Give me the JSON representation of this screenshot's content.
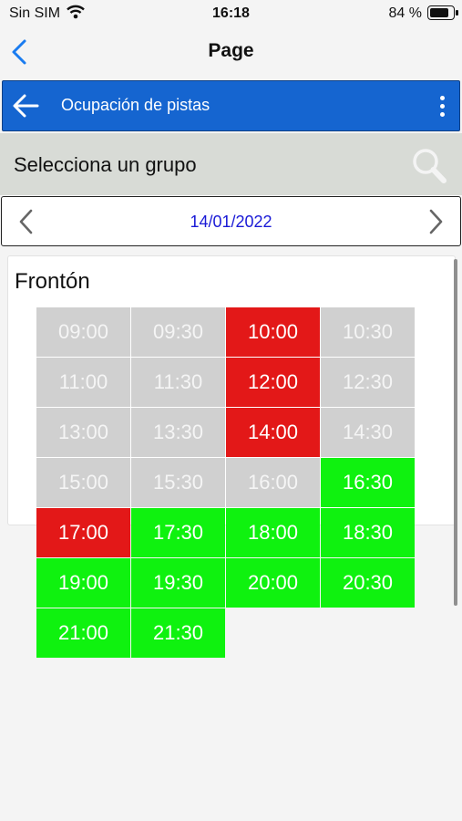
{
  "status_bar": {
    "carrier": "Sin SIM",
    "time": "16:18",
    "battery": "84 %"
  },
  "nav": {
    "title": "Page"
  },
  "app_bar": {
    "title": "Ocupación de pistas"
  },
  "group": {
    "label": "Selecciona un grupo"
  },
  "date_bar": {
    "date": "14/01/2022"
  },
  "court": {
    "name": "Frontón"
  },
  "colors": {
    "past": "#d0d0d0",
    "busy": "#e31818",
    "free": "#0ff20f",
    "accent": "#1565d0"
  },
  "slots": [
    {
      "time": "09:00",
      "state": "past"
    },
    {
      "time": "09:30",
      "state": "past"
    },
    {
      "time": "10:00",
      "state": "busy"
    },
    {
      "time": "10:30",
      "state": "past"
    },
    {
      "time": "11:00",
      "state": "past"
    },
    {
      "time": "11:30",
      "state": "past"
    },
    {
      "time": "12:00",
      "state": "busy"
    },
    {
      "time": "12:30",
      "state": "past"
    },
    {
      "time": "13:00",
      "state": "past"
    },
    {
      "time": "13:30",
      "state": "past"
    },
    {
      "time": "14:00",
      "state": "busy"
    },
    {
      "time": "14:30",
      "state": "past"
    },
    {
      "time": "15:00",
      "state": "past"
    },
    {
      "time": "15:30",
      "state": "past"
    },
    {
      "time": "16:00",
      "state": "past"
    },
    {
      "time": "16:30",
      "state": "free"
    },
    {
      "time": "17:00",
      "state": "busy"
    },
    {
      "time": "17:30",
      "state": "free"
    },
    {
      "time": "18:00",
      "state": "free"
    },
    {
      "time": "18:30",
      "state": "free"
    },
    {
      "time": "19:00",
      "state": "free"
    },
    {
      "time": "19:30",
      "state": "free"
    },
    {
      "time": "20:00",
      "state": "free"
    },
    {
      "time": "20:30",
      "state": "free"
    },
    {
      "time": "21:00",
      "state": "free"
    },
    {
      "time": "21:30",
      "state": "free"
    }
  ]
}
